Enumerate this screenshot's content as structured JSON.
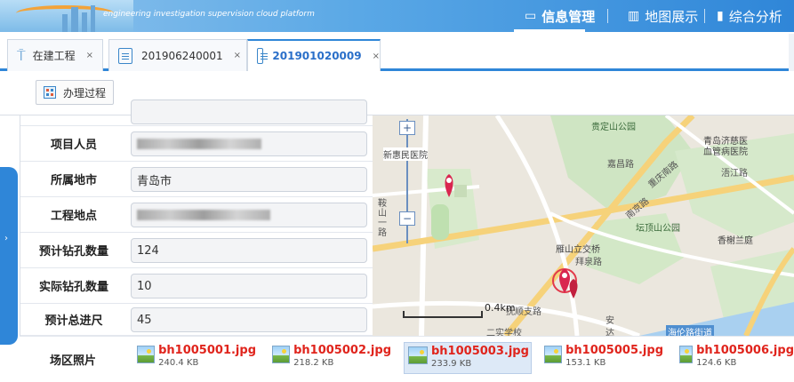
{
  "header": {
    "platform_title": "engineering investigation supervision cloud platform",
    "nav": [
      {
        "label": "信息管理",
        "icon": "info-manage-icon",
        "active": true
      },
      {
        "label": "地图展示",
        "icon": "map-display-icon",
        "active": false
      },
      {
        "label": "综合分析",
        "icon": "chart-analysis-icon",
        "active": false
      }
    ]
  },
  "tabs": [
    {
      "label": "在建工程",
      "icon": "construction-crane-icon",
      "active": false,
      "close": "×"
    },
    {
      "label": "201906240001",
      "icon": "edit-document-icon",
      "active": false,
      "close": "×"
    },
    {
      "label": "201901020009",
      "icon": "edit-document-icon",
      "active": true,
      "close": "×"
    }
  ],
  "toolbar": {
    "process_label": "办理过程"
  },
  "form": {
    "rows": [
      {
        "label": "项目人员",
        "value": ""
      },
      {
        "label": "所属地市",
        "value": "青岛市"
      },
      {
        "label": "工程地点",
        "value": ""
      },
      {
        "label": "预计钻孔数量",
        "value": "124"
      },
      {
        "label": "实际钻孔数量",
        "value": "10"
      },
      {
        "label": "预计总进尺",
        "value": "45"
      }
    ],
    "photos_label": "场区照片"
  },
  "map": {
    "labels": {
      "park1": "贵定山公园",
      "hospital1": "青岛济慈医",
      "hospital1b": "血管病医院",
      "hospital2": "新惠民医院",
      "road1": "嘉昌路",
      "road2": "重庆南路",
      "road3": "南京路",
      "road4": "浯江路",
      "park2": "坛顶山公园",
      "road5": "香榭兰庭",
      "road6": "鞍山一路",
      "bridge": "雁山立交桥",
      "road7": "拜泉路",
      "road8": "抚顺支路",
      "school": "二实学校",
      "an": "安",
      "da": "达",
      "road9": "海伦路街道",
      "scale": "0.4km"
    },
    "zoom_plus": "+",
    "zoom_minus": "−"
  },
  "photos": [
    {
      "name": "bh1005001.jpg",
      "size": "240.4 KB",
      "selected": false
    },
    {
      "name": "bh1005002.jpg",
      "size": "218.2 KB",
      "selected": false
    },
    {
      "name": "bh1005003.jpg",
      "size": "233.9 KB",
      "selected": true
    },
    {
      "name": "bh1005005.jpg",
      "size": "153.1 KB",
      "selected": false
    },
    {
      "name": "bh1005006.jpg",
      "size": "124.6 KB",
      "selected": false
    }
  ],
  "colors": {
    "accent": "#2f86d8",
    "marker": "#d9264f",
    "photo_name": "#e0241c"
  }
}
